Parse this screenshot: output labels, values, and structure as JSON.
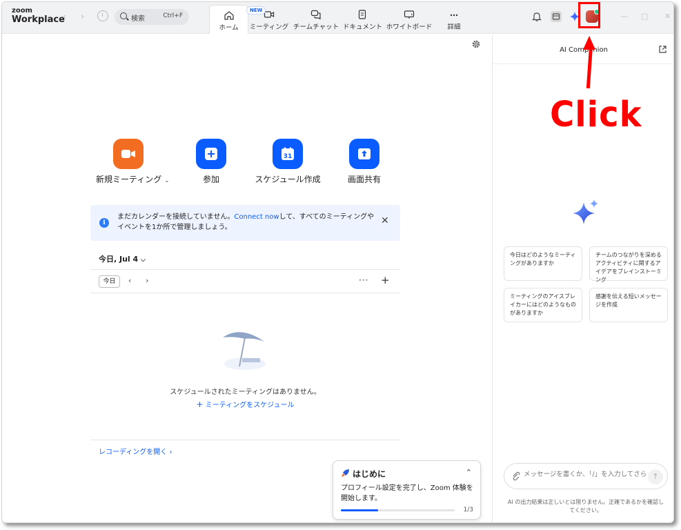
{
  "app": {
    "logo_small": "zoom",
    "logo_big": "Workplace"
  },
  "search": {
    "label": "検索",
    "shortcut": "Ctrl+F"
  },
  "tabs": [
    {
      "label": "ホーム",
      "icon": "home-icon",
      "active": true
    },
    {
      "label": "ミーティング",
      "icon": "video-icon"
    },
    {
      "label": "チームチャット",
      "icon": "chat-icon"
    },
    {
      "label": "ドキュメント",
      "icon": "document-icon"
    },
    {
      "label": "ホワイトボード",
      "icon": "whiteboard-icon"
    },
    {
      "label": "詳細",
      "icon": "more-icon",
      "badge": "NEW"
    }
  ],
  "actions": [
    {
      "label": "新規ミーティング",
      "icon": "video-camera-icon",
      "color": "#f26d21"
    },
    {
      "label": "参加",
      "icon": "plus-icon",
      "color": "#0b5cff"
    },
    {
      "label": "スケジュール作成",
      "icon": "calendar-icon",
      "color": "#0b5cff",
      "calendar_day": "31"
    },
    {
      "label": "画面共有",
      "icon": "share-screen-icon",
      "color": "#0b5cff"
    }
  ],
  "banner": {
    "text_before": "まだカレンダーを接続していません。",
    "link": "Connect now",
    "text_after": "して、すべてのミーティングやイベントを1か所で管理しましょう。"
  },
  "calendar": {
    "heading": "今日, Jul 4",
    "today_button": "今日",
    "empty_text": "スケジュールされたミーティングはありません。",
    "schedule_link": "ミーティングをスケジュール",
    "recordings_link": "レコーディングを開く"
  },
  "getting_started": {
    "title": "はじめに",
    "description": "プロフィール設定を完了し、Zoom 体験を開始します。",
    "progress": 0.33,
    "count": "1/3"
  },
  "panel": {
    "title": "AI Companion",
    "suggestions": [
      "今日はどのようなミーティングがありますか",
      "チームのつながりを深めるアクティビティに関するアイデアをブレインストーミング",
      "ミーティングのアイスブレイカーにはどのようなものがありますか",
      "感謝を伝える短いメッセージを作成"
    ],
    "input_placeholder": "メッセージを書くか、「/」を入力してさらに...",
    "disclaimer": "AI の出力結果は正しいとは限りません。正確であるかを確認してください。"
  },
  "annotation": {
    "text": "Click",
    "color": "#ff0000"
  }
}
